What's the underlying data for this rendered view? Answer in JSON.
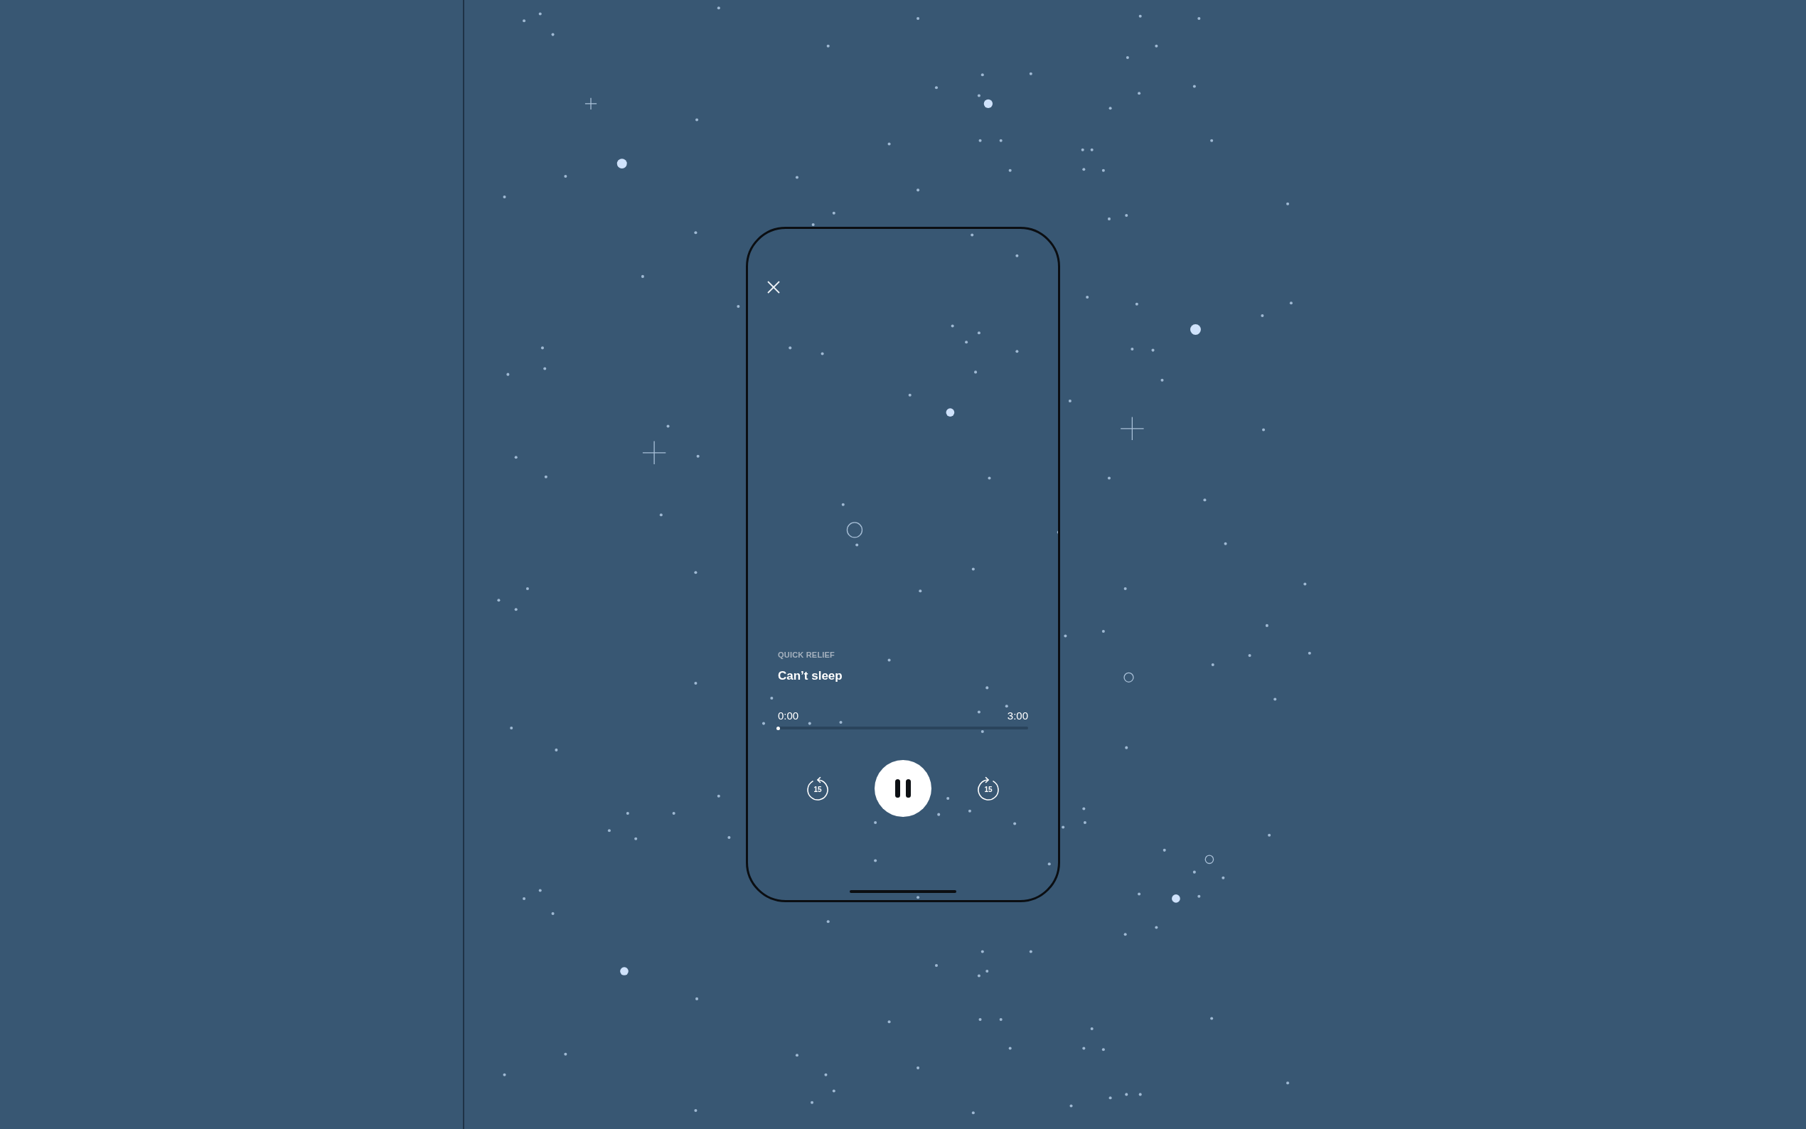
{
  "session": {
    "category": "QUICK RELIEF",
    "title": "Can’t sleep"
  },
  "progress": {
    "elapsed": "0:00",
    "duration": "3:00",
    "level": 0
  },
  "controls": {
    "skip_back": "15",
    "skip_forward": "15",
    "playing": true
  }
}
